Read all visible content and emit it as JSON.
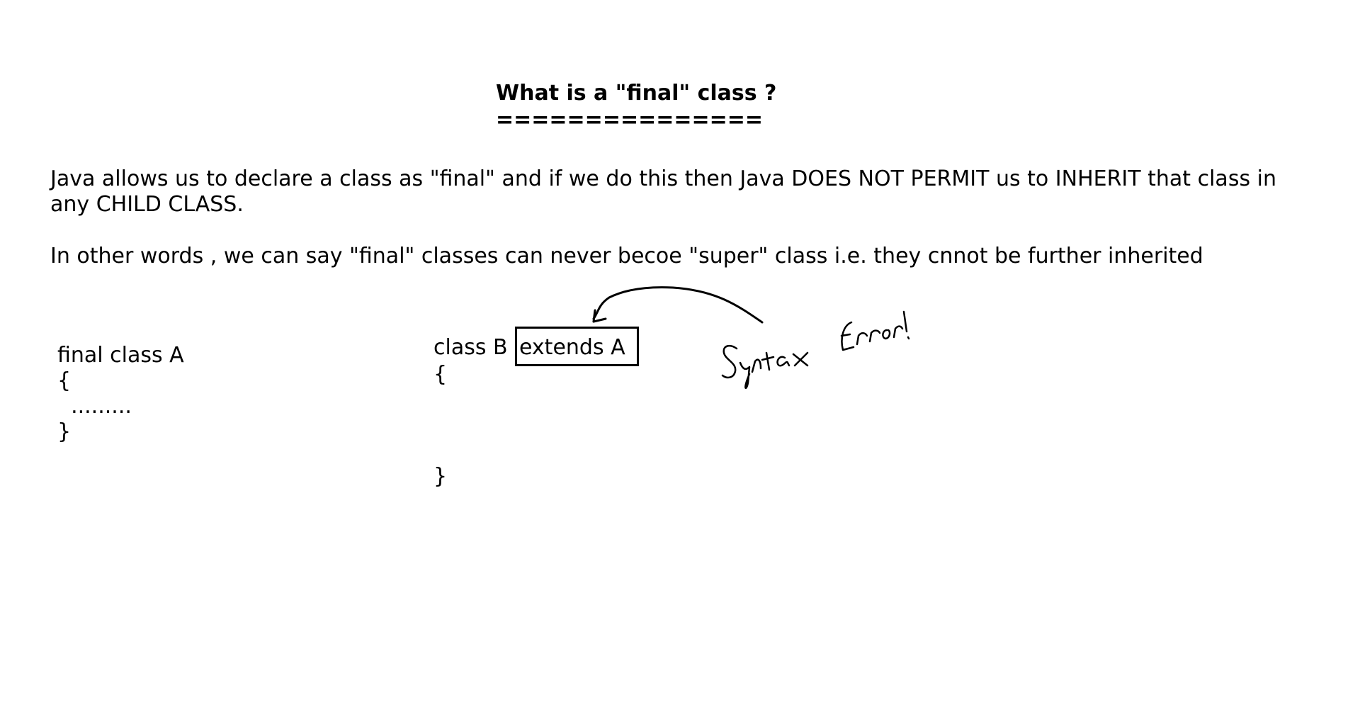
{
  "heading": {
    "title": "What is a \"final\" class ?",
    "rule": "==============="
  },
  "body": {
    "paragraph1_line1": "Java allows us to declare a class as \"final\" and if we do this then Java DOES NOT PERMIT us to INHERIT that class in",
    "paragraph1_line2": "any CHILD CLASS.",
    "paragraph2": "In other words , we can say \"final\" classes can never becoe \"super\" class i.e. they cnnot be further inherited"
  },
  "example_a": {
    "line1": "final class A",
    "line2": "{",
    "line3": "  .........",
    "line4": "}"
  },
  "example_b": {
    "class_decl": "class B",
    "extends_clause": "extends A",
    "open_brace": "{",
    "close_brace": "}"
  },
  "annotation": {
    "handwritten_note": "Syntax Error!"
  }
}
